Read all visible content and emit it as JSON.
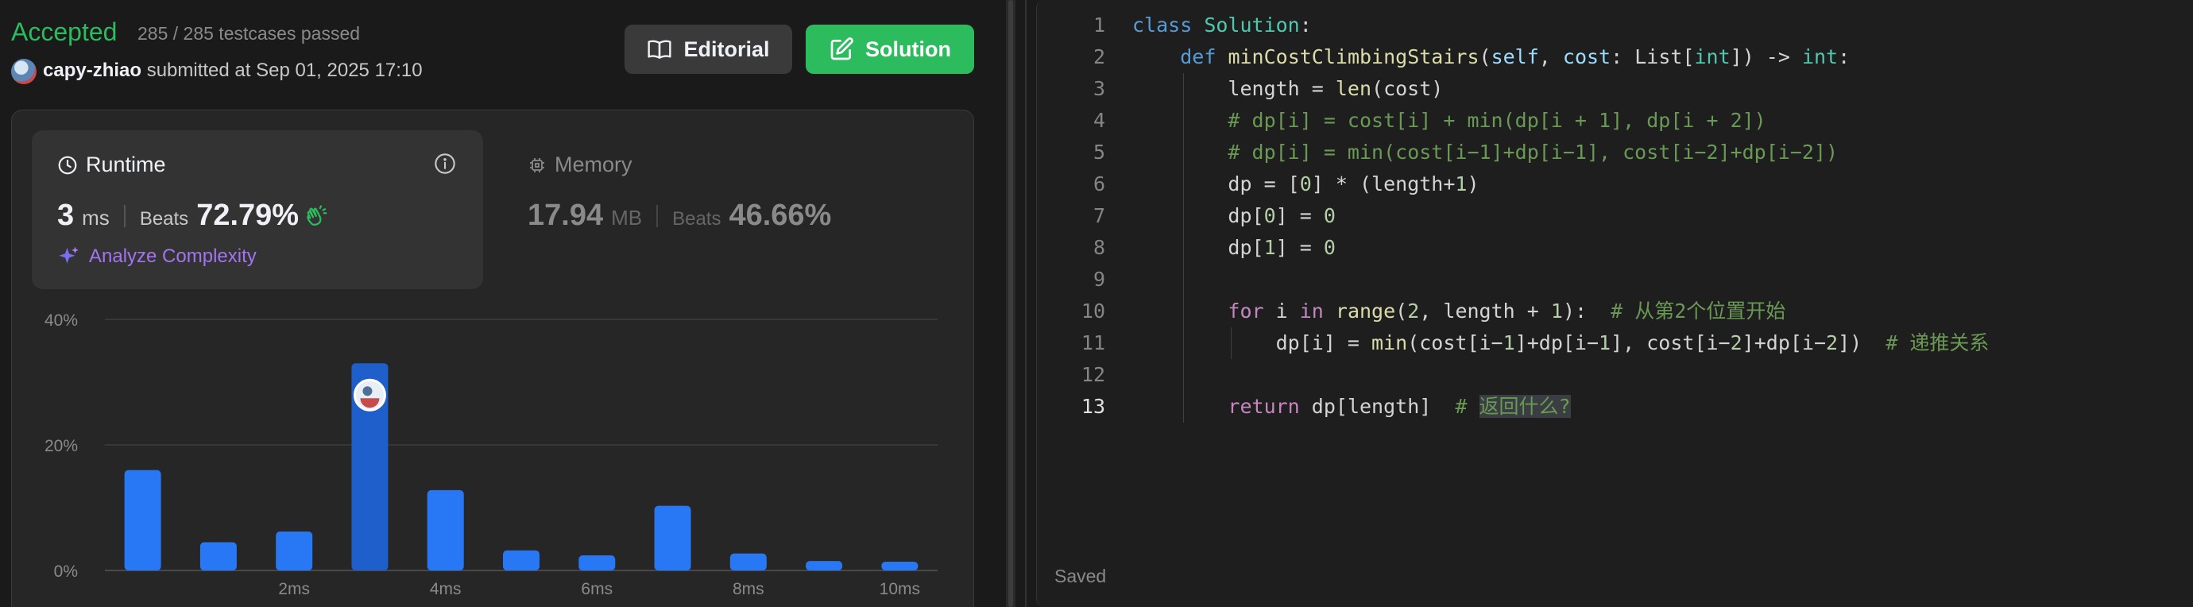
{
  "submission": {
    "status": "Accepted",
    "testcases": "285 / 285 testcases passed",
    "username": "capy-zhiao",
    "submitted_text": "submitted at Sep 01, 2025 17:10"
  },
  "buttons": {
    "editorial": "Editorial",
    "solution": "Solution"
  },
  "runtime": {
    "label": "Runtime",
    "value": "3",
    "unit": "ms",
    "beats_label": "Beats",
    "beats": "72.79%",
    "analyze": "Analyze Complexity"
  },
  "memory": {
    "label": "Memory",
    "value": "17.94",
    "unit": "MB",
    "beats_label": "Beats",
    "beats": "46.66%"
  },
  "colors": {
    "accent_green": "#2cbb5d",
    "bar_blue": "#2877f5",
    "bar_highlight": "#1f5fcc",
    "analyze_purple": "#a374f0"
  },
  "chart_data": {
    "type": "bar",
    "y_ticks": [
      "0%",
      "20%",
      "40%"
    ],
    "ylim": [
      0,
      40
    ],
    "x_tick_labels": [
      "2ms",
      "4ms",
      "6ms",
      "8ms",
      "10ms"
    ],
    "values": [
      16,
      4.5,
      6.2,
      33,
      12.8,
      3.2,
      2.4,
      10.3,
      2.7,
      1.5,
      1.4
    ],
    "highlight_index": 3,
    "grid": true
  },
  "editor": {
    "saved_label": "Saved",
    "active_line": 13
  }
}
